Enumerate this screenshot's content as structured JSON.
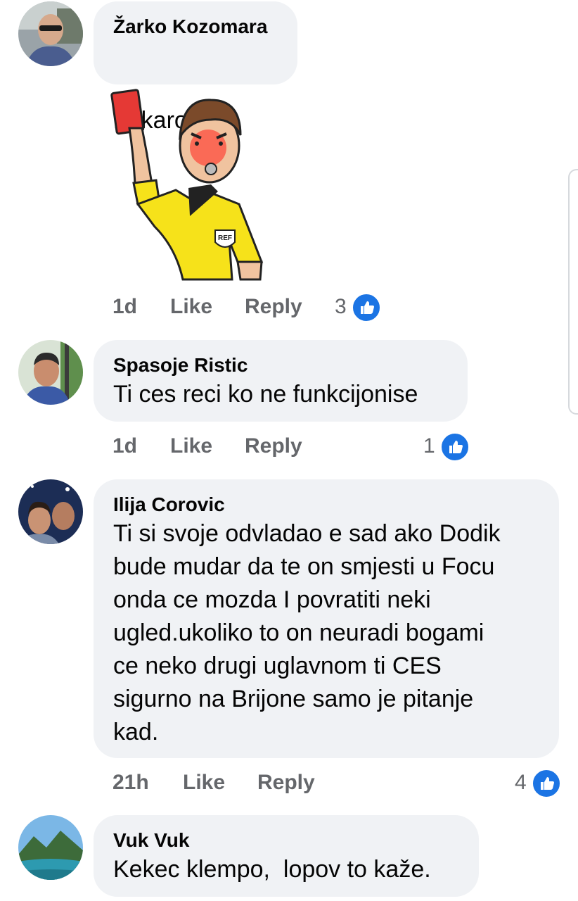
{
  "comments": [
    {
      "author": "Žarko Kozomara",
      "text": "Fukaro,",
      "emoji_icon": "nauseated-face-icon",
      "sticker": {
        "icon": "referee-red-card-sticker",
        "badge_text": "REF"
      },
      "time": "1d",
      "like_label": "Like",
      "reply_label": "Reply",
      "reaction_count": "3"
    },
    {
      "author": "Spasoje Ristic",
      "text": "Ti ces reci ko ne funkcijonise",
      "time": "1d",
      "like_label": "Like",
      "reply_label": "Reply",
      "reaction_count": "1"
    },
    {
      "author": "Ilija Corovic",
      "text": "Ti si svoje odvladao e sad ako Dodik\nbude mudar da te on smjesti u Focu\nonda ce mozda I povratiti neki\nugled.ukoliko to on neuradi bogami\nce neko drugi uglavnom ti CES\nsigurno na Brijone samo je pitanje\nkad.",
      "time": "21h",
      "like_label": "Like",
      "reply_label": "Reply",
      "reaction_count": "4"
    },
    {
      "author": "Vuk Vuk",
      "text": "Kekec klempo,  lopov to kaže."
    }
  ],
  "colors": {
    "bubble": "#f0f2f5",
    "meta_text": "#65676b",
    "like_blue": "#1b74e4",
    "red_card": "#e53935",
    "ref_shirt": "#f6e21a"
  }
}
